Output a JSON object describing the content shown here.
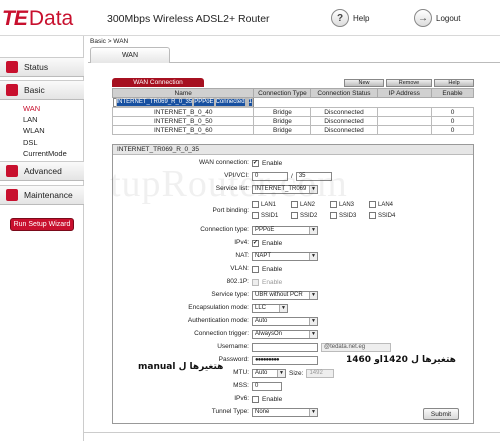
{
  "brand": {
    "logo_te": "TE",
    "logo_data": "Data",
    "title": "300Mbps Wireless ADSL2+ Router"
  },
  "header": {
    "help": {
      "icon": "help-icon",
      "label": "Help"
    },
    "logout": {
      "icon": "logout-icon",
      "label": "Logout"
    }
  },
  "sidebar": {
    "status": "Status",
    "basic": "Basic",
    "basic_items": [
      "WAN",
      "LAN",
      "WLAN",
      "DSL",
      "CurrentMode"
    ],
    "advanced": "Advanced",
    "maintenance": "Maintenance",
    "wizard": "Run Setup Wizard",
    "accent": "#c8102e"
  },
  "breadcrumb": "Basic > WAN",
  "tab": "WAN",
  "wan_table": {
    "label": "WAN Connection",
    "actions": [
      "New",
      "Remove",
      "Help"
    ],
    "columns": [
      "Name",
      "Connection Type",
      "Connection Status",
      "IP Address",
      "Enable"
    ],
    "rows": [
      [
        "INTERNET_TR069_R_0_35",
        "PPPoE",
        "Connected",
        "",
        "1"
      ],
      [
        "INTERNET_B_0_40",
        "Bridge",
        "Disconnected",
        "",
        "0"
      ],
      [
        "INTERNET_B_0_50",
        "Bridge",
        "Disconnected",
        "",
        "0"
      ],
      [
        "INTERNET_B_0_60",
        "Bridge",
        "Disconnected",
        "",
        "0"
      ]
    ]
  },
  "detail": {
    "title": "INTERNET_TR069_R_0_35",
    "labels": {
      "wan_connection": "WAN connection:",
      "vpi_vci": "VPI/VCI:",
      "service_list": "Service list:",
      "port_binding": "Port binding:",
      "connection_type": "Connection type:",
      "ipv4": "IPv4:",
      "nat": "NAT:",
      "vlan": "VLAN:",
      "p8021": "802.1P:",
      "service_type": "Service type:",
      "encapsulation": "Encapsulation mode:",
      "auth": "Authentication mode:",
      "trigger": "Connection trigger:",
      "username": "Username:",
      "password": "Password:",
      "mtu": "MTU:",
      "mss": "MSS:",
      "ipv6": "IPv6:",
      "tunnel": "Tunnel Type:"
    },
    "enable": "Enable",
    "vpi": "0",
    "vci": "35",
    "vpi_sep": "/",
    "service_list_value": "INTERNET_TR069",
    "ports": [
      "LAN1",
      "LAN2",
      "LAN3",
      "LAN4",
      "SSID1",
      "SSID2",
      "SSID3",
      "SSID4"
    ],
    "connection_type_value": "PPPoE",
    "nat_value": "NAPT",
    "service_type_value": "UBR without PCR",
    "encapsulation_value": "LLC",
    "auth_value": "Auto",
    "trigger_value": "AlwaysOn",
    "username_value": "",
    "username_suffix": "@tedata.net.eg",
    "password_value": "●●●●●●●●●",
    "mtu_value": "Auto",
    "size_label": "Size:",
    "size_value": "1492",
    "mss_value": "0",
    "tunnel_value": "None",
    "submit": "Submit"
  },
  "annotations": {
    "left": "manual هتغيرها ل",
    "right": "هتغيرها ل 1420او 1460"
  },
  "watermark": "tupRouter.com"
}
